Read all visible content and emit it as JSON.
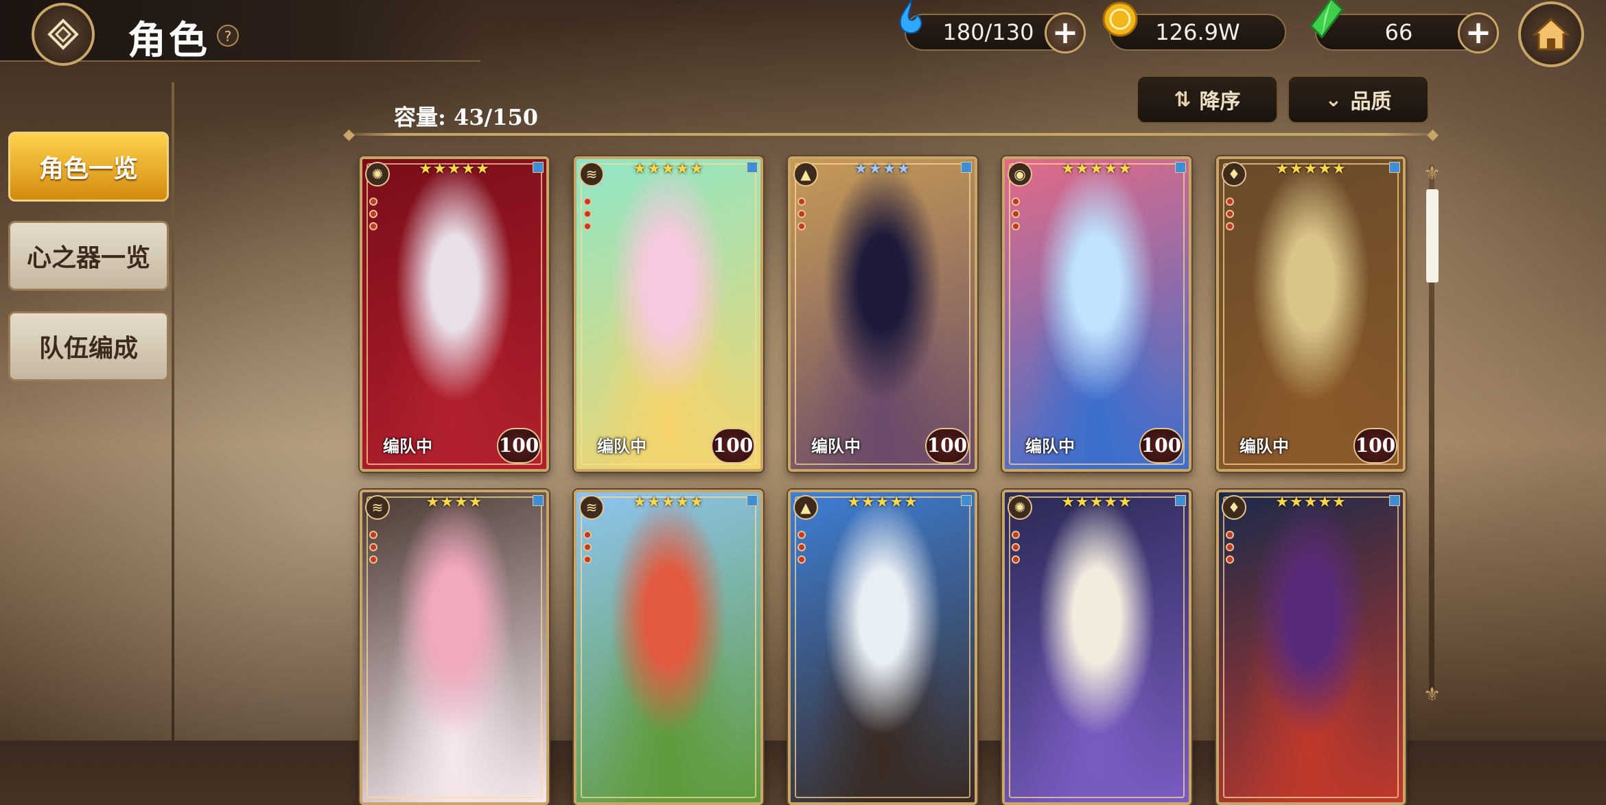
{
  "header": {
    "title": "角色",
    "help": "?"
  },
  "currencies": [
    {
      "name": "stamina",
      "value": "180/130",
      "color": "#2fa8ff"
    },
    {
      "name": "gold",
      "value": "126.9W",
      "color": "#f2b61b"
    },
    {
      "name": "gem",
      "value": "66",
      "color": "#3fcf4a"
    }
  ],
  "toolbar": {
    "sort_label": "降序",
    "filter_label": "品质"
  },
  "capacity": "容量: 43/150",
  "sidebar": {
    "items": [
      {
        "label": "角色一览",
        "active": true
      },
      {
        "label": "心之器一览",
        "active": false
      },
      {
        "label": "队伍编成",
        "active": false
      }
    ]
  },
  "cards": [
    {
      "element": "light",
      "stars": "★★★★★",
      "star_color": "#ffd84a",
      "status": "编队中",
      "level": "100",
      "art": [
        "#7a0d1b",
        "#e8dfe8",
        "#b3202f"
      ]
    },
    {
      "element": "wind",
      "stars": "★★★★★",
      "star_color": "#ffd84a",
      "status": "编队中",
      "level": "100",
      "art": [
        "#8ee6c7",
        "#f7c9e0",
        "#f5d36b"
      ]
    },
    {
      "element": "earth",
      "stars": "★★★★",
      "star_color": "#9ec8ff",
      "status": "编队中",
      "level": "100",
      "art": [
        "#c79b55",
        "#1d1a3a",
        "#6a4a6a"
      ]
    },
    {
      "element": "water",
      "stars": "★★★★★",
      "star_color": "#ffd84a",
      "status": "编队中",
      "level": "100",
      "art": [
        "#e36a86",
        "#bfe3ff",
        "#3a6fcf"
      ]
    },
    {
      "element": "fire",
      "stars": "★★★★★",
      "star_color": "#ffd84a",
      "status": "编队中",
      "level": "100",
      "art": [
        "#6a4a2a",
        "#d9c48a",
        "#8b5a2b"
      ]
    },
    {
      "element": "wind",
      "stars": "★★★★",
      "star_color": "#ffd84a",
      "status": "",
      "level": "",
      "art": [
        "#4a3a32",
        "#f2a8bd",
        "#f7e8ee"
      ]
    },
    {
      "element": "wind",
      "stars": "★★★★★",
      "star_color": "#ffd84a",
      "status": "",
      "level": "",
      "art": [
        "#8fc3f0",
        "#e35a40",
        "#5e9b3a"
      ]
    },
    {
      "element": "earth",
      "stars": "★★★★★",
      "star_color": "#ffd84a",
      "status": "",
      "level": "",
      "art": [
        "#3e7fd6",
        "#e8eef5",
        "#3a2a22"
      ]
    },
    {
      "element": "light",
      "stars": "★★★★★",
      "star_color": "#ffd84a",
      "status": "",
      "level": "",
      "art": [
        "#2a2a55",
        "#f3ecde",
        "#7b5cc2"
      ]
    },
    {
      "element": "fire",
      "stars": "★★★★★",
      "star_color": "#ffd84a",
      "status": "",
      "level": "",
      "art": [
        "#1b2a4a",
        "#5a2a7a",
        "#c0392b"
      ]
    }
  ],
  "element_glyphs": {
    "light": "✺",
    "wind": "≋",
    "earth": "▲",
    "water": "◉",
    "fire": "♦"
  },
  "scroll": {
    "position": 0.05
  }
}
